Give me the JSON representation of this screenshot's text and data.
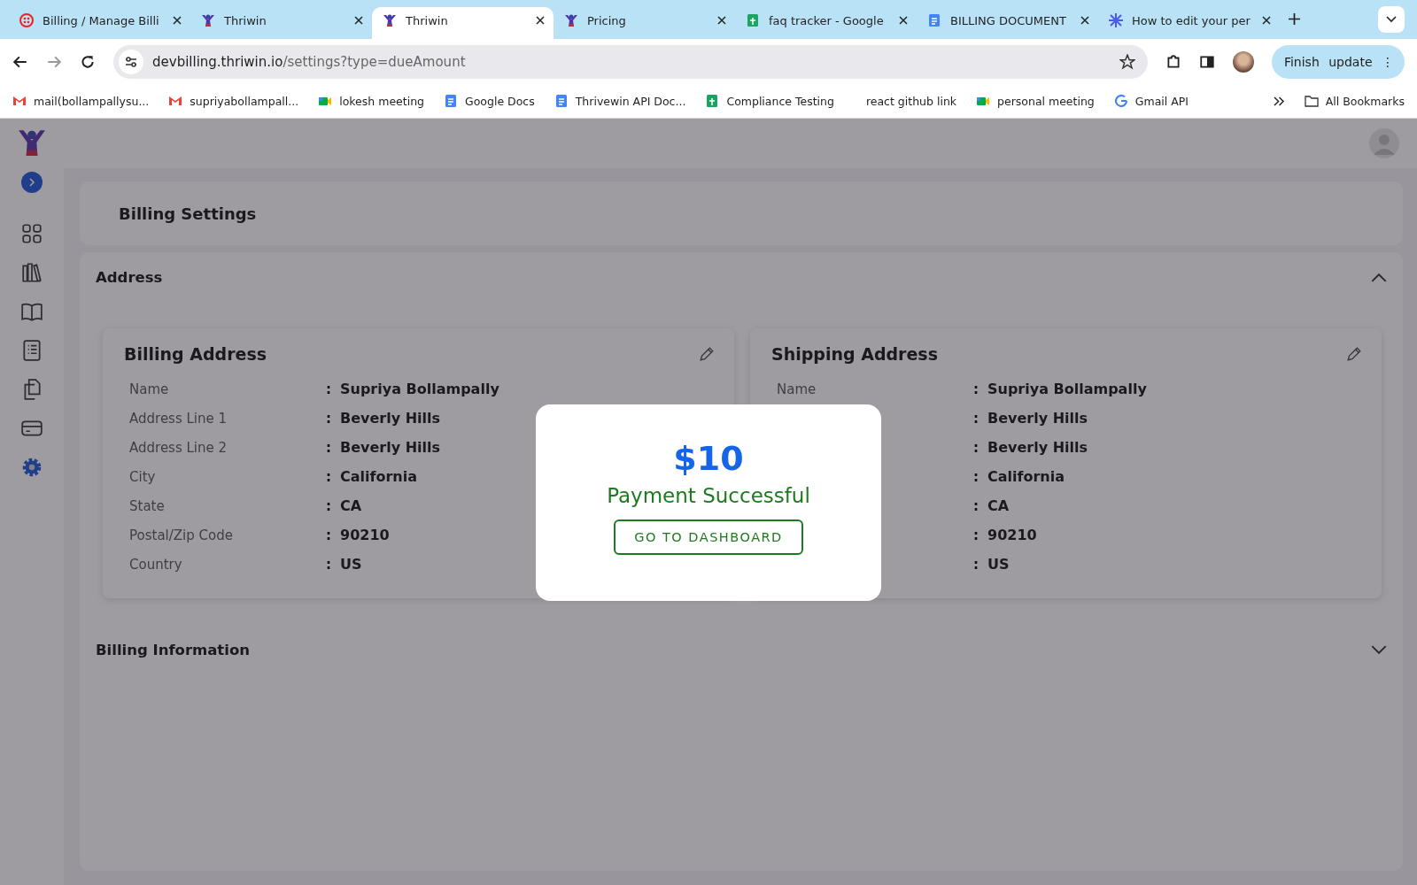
{
  "browser": {
    "tabs": [
      {
        "title": "Billing / Manage Billi",
        "kind": "dots",
        "selected": false
      },
      {
        "title": "Thriwin",
        "kind": "thriwin",
        "selected": false
      },
      {
        "title": "Thriwin",
        "kind": "thriwin",
        "selected": true
      },
      {
        "title": "Pricing",
        "kind": "thriwin",
        "selected": false
      },
      {
        "title": "faq tracker - Google",
        "kind": "sheets",
        "selected": false
      },
      {
        "title": "BILLING DOCUMENT",
        "kind": "docs",
        "selected": false
      },
      {
        "title": "How to edit your per",
        "kind": "spark",
        "selected": false
      }
    ],
    "url_host": "devbilling.thriwin.io",
    "url_path": "/settings?type=dueAmount",
    "update_button": "Finish update",
    "update_menu": "⋮",
    "bookmarks": [
      {
        "label": "mail(bollampallysu...",
        "kind": "gmail"
      },
      {
        "label": "supriyabollampall...",
        "kind": "gmail"
      },
      {
        "label": "lokesh meeting",
        "kind": "meet"
      },
      {
        "label": "Google Docs",
        "kind": "docs"
      },
      {
        "label": "Thrivewin API Doc...",
        "kind": "docs"
      },
      {
        "label": "Compliance Testing",
        "kind": "sheets"
      },
      {
        "label": "react github link",
        "kind": "plain"
      },
      {
        "label": "personal meeting",
        "kind": "meet"
      },
      {
        "label": "Gmail API",
        "kind": "google"
      }
    ],
    "all_bookmarks": "All Bookmarks"
  },
  "sidebar": {
    "items": [
      {
        "kind": "grid",
        "selected": false
      },
      {
        "kind": "library",
        "selected": false
      },
      {
        "kind": "book",
        "selected": false
      },
      {
        "kind": "list",
        "selected": false
      },
      {
        "kind": "copy",
        "selected": false
      },
      {
        "kind": "card",
        "selected": false
      },
      {
        "kind": "gear",
        "selected": true
      }
    ]
  },
  "page_title": "Billing Settings",
  "sections": [
    {
      "title": "Address",
      "expanded": true,
      "cards": [
        {
          "title": "Billing Address",
          "rows": [
            {
              "label": "Name",
              "colon": ":",
              "value": "Supriya Bollampally"
            },
            {
              "label": "Address Line 1",
              "colon": ":",
              "value": "Beverly Hills"
            },
            {
              "label": "Address Line 2",
              "colon": ":",
              "value": "Beverly Hills"
            },
            {
              "label": "City",
              "colon": ":",
              "value": "California"
            },
            {
              "label": "State",
              "colon": ":",
              "value": "CA"
            },
            {
              "label": "Postal/Zip Code",
              "colon": ":",
              "value": "90210"
            },
            {
              "label": "Country",
              "colon": ":",
              "value": "US"
            }
          ]
        },
        {
          "title": "Shipping Address",
          "rows": [
            {
              "label": "Name",
              "colon": ":",
              "value": "Supriya Bollampally"
            },
            {
              "colon": ":",
              "value": "Beverly Hills"
            },
            {
              "colon": ":",
              "value": "Beverly Hills"
            },
            {
              "colon": ":",
              "value": "California"
            },
            {
              "colon": ":",
              "value": "CA"
            },
            {
              "colon": ":",
              "value": "90210"
            },
            {
              "colon": ":",
              "value": "US"
            }
          ]
        }
      ]
    },
    {
      "title": "Billing Information",
      "expanded": false
    }
  ],
  "modal": {
    "amount": "$10",
    "message": "Payment Successful",
    "button": "GO TO DASHBOARD"
  }
}
